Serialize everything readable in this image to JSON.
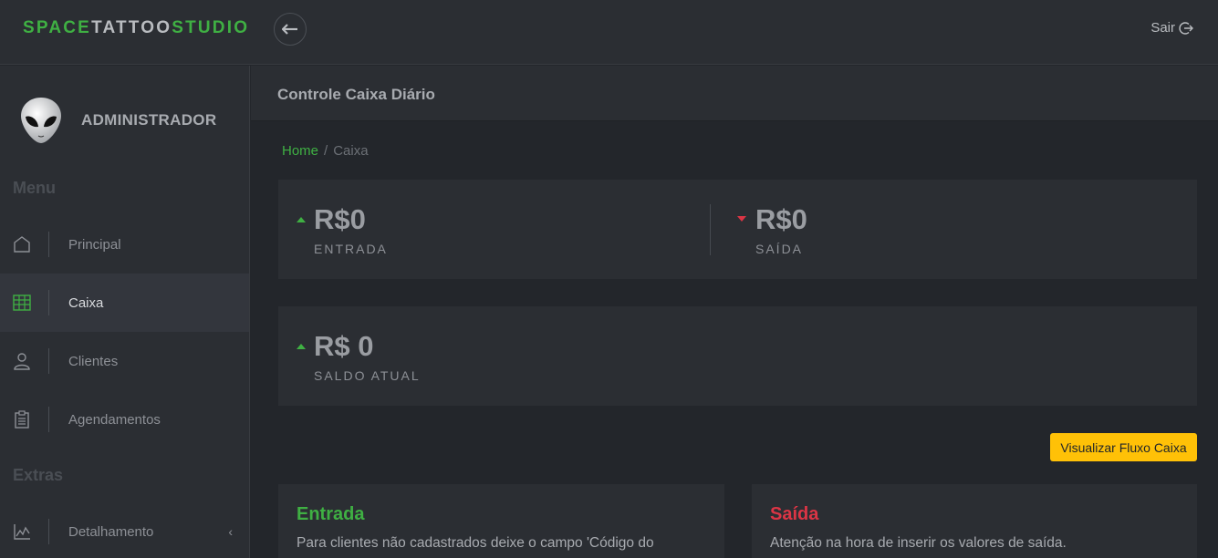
{
  "brand": {
    "part1": "SPACE",
    "part2": "TATTOO",
    "part3": "STUDIO"
  },
  "topbar": {
    "logout_label": "Sair"
  },
  "sidebar": {
    "admin_name": "ADMINISTRADOR",
    "menu_title": "Menu",
    "extras_title": "Extras",
    "items": [
      {
        "label": "Principal",
        "icon": "home-icon"
      },
      {
        "label": "Caixa",
        "icon": "table-grid-icon"
      },
      {
        "label": "Clientes",
        "icon": "user-icon"
      },
      {
        "label": "Agendamentos",
        "icon": "clipboard-icon"
      },
      {
        "label": "Detalhamento",
        "icon": "line-chart-icon"
      }
    ]
  },
  "page": {
    "title": "Controle Caixa Diário"
  },
  "breadcrumb": {
    "home": "Home",
    "separator": "/",
    "current": "Caixa"
  },
  "stats": {
    "entrada": {
      "value": "R$0",
      "label": "ENTRADA"
    },
    "saida": {
      "value": "R$0",
      "label": "SAÍDA"
    },
    "saldo": {
      "value": "R$ 0",
      "label": "SALDO ATUAL"
    }
  },
  "buttons": {
    "fluxo": "Visualizar Fluxo Caixa"
  },
  "panels": {
    "entrada": {
      "title": "Entrada",
      "text": "Para clientes não cadastrados deixe o campo 'Código do"
    },
    "saida": {
      "title": "Saída",
      "text": "Atenção na hora de inserir os valores de saída."
    }
  },
  "colors": {
    "accent_green": "#3fb043",
    "accent_red": "#dc3545",
    "warning": "#ffc107"
  }
}
